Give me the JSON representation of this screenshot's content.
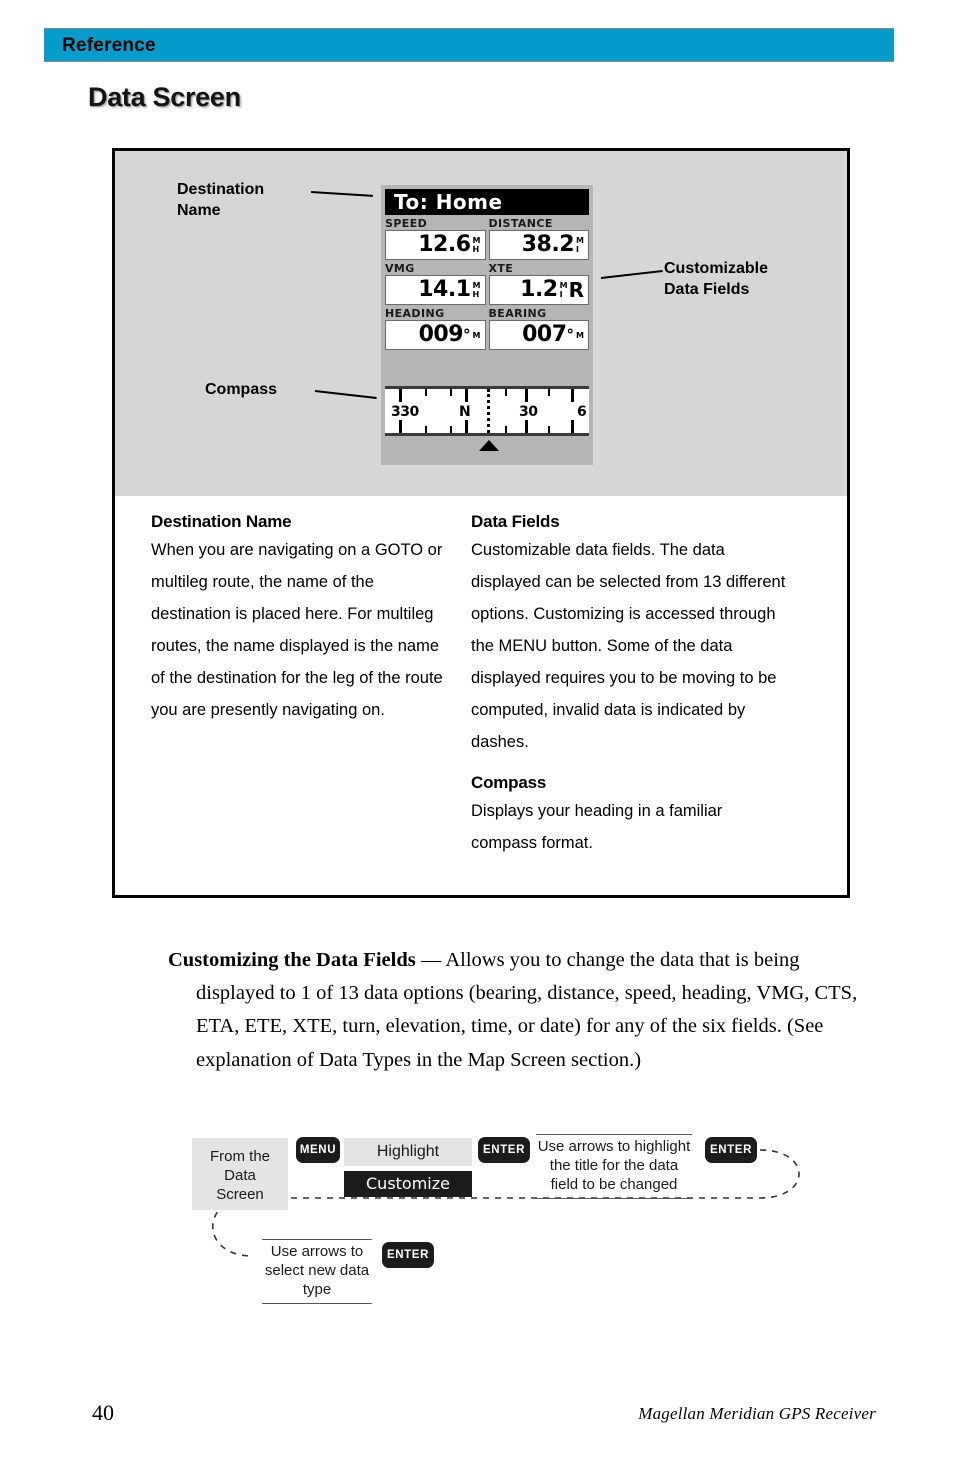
{
  "header": {
    "section_label": "Reference",
    "bar_color": "#059ccb",
    "page_title": "Data Screen"
  },
  "callouts": {
    "destination_name": "Destination\nName",
    "destination_name_line1": "Destination",
    "destination_name_line2": "Name",
    "compass": "Compass",
    "data_fields_line1": "Customizable",
    "data_fields_line2": "Data  Fields"
  },
  "gps_screen": {
    "title": "To:  Home",
    "fields": [
      {
        "label": "SPEED",
        "value": "12.6",
        "unit_top": "M",
        "unit_bottom": "H",
        "suffix": ""
      },
      {
        "label": "DISTANCE",
        "value": "38.2",
        "unit_top": "M",
        "unit_bottom": "I",
        "suffix": ""
      },
      {
        "label": "VMG",
        "value": "14.1",
        "unit_top": "M",
        "unit_bottom": "H",
        "suffix": ""
      },
      {
        "label": "XTE",
        "value": "1.2",
        "unit_top": "M",
        "unit_bottom": "I",
        "suffix": "R"
      },
      {
        "label": "HEADING",
        "value": "009",
        "degree": "°",
        "unit_small": "M"
      },
      {
        "label": "BEARING",
        "value": "007",
        "degree": "°",
        "unit_small": "M"
      }
    ],
    "compass": {
      "labels": [
        "330",
        "N",
        "30",
        "6"
      ],
      "pointer": "up-triangle"
    }
  },
  "explanations": {
    "left": [
      {
        "heading": "Destination Name",
        "body": "When you are navigating on a GOTO or multileg route, the name of the destination is placed here.  For multileg routes, the name displayed is the name of the destination for the leg of the route you are presently navigating on."
      }
    ],
    "right": [
      {
        "heading": "Data Fields",
        "body": "Customizable data fields.  The data displayed can be selected from 13 different options.  Customizing is accessed through the MENU button.  Some of the data displayed requires you to be moving to be computed, invalid data is indicated by dashes."
      },
      {
        "heading": "Compass",
        "body": "Displays your heading in a familiar compass format."
      }
    ]
  },
  "paragraph": {
    "lead": "Customizing the Data Fields",
    "dash": " — ",
    "body": "Allows you to change the data that is being displayed to 1 of 13 data options (bearing, distance, speed, heading, VMG, CTS, ETA, ETE, XTE, turn, elevation, time, or date) for any of the six fields. (See explanation of Data Types in the Map Screen section.)"
  },
  "flow": {
    "from_data_screen": "From the\nData\nScreen",
    "from_line1": "From the",
    "from_line2": "Data",
    "from_line3": "Screen",
    "key_menu": "MENU",
    "highlight_label": "Highlight",
    "customize_label": "Customize",
    "key_enter_1": "ENTER",
    "step_highlight_title": "Use arrows to highlight the title for the data field to be changed",
    "key_enter_2": "ENTER",
    "step_select_type": "Use arrows to select  new data type",
    "key_enter_3": "ENTER"
  },
  "footer": {
    "page_number": "40",
    "brand": "Magellan Meridian GPS Receiver"
  }
}
